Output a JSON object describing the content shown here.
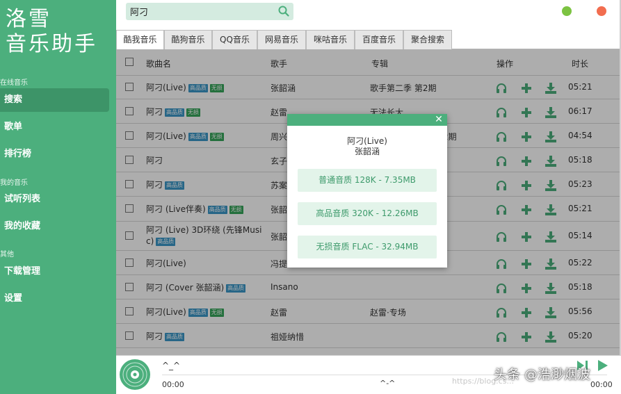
{
  "app": {
    "logo_line1": "洛雪",
    "logo_line2": "音乐助手"
  },
  "sidebar": {
    "sections": [
      {
        "title": "在线音乐",
        "items": [
          {
            "label": "搜索",
            "active": true
          },
          {
            "label": "歌单"
          },
          {
            "label": "排行榜"
          }
        ]
      },
      {
        "title": "我的音乐",
        "items": [
          {
            "label": "试听列表"
          },
          {
            "label": "我的收藏"
          }
        ]
      },
      {
        "title": "其他",
        "items": [
          {
            "label": "下载管理"
          },
          {
            "label": "设置"
          }
        ]
      }
    ]
  },
  "search": {
    "value": "阿刁",
    "icon": "search-icon"
  },
  "window_controls": {
    "minimize_color": "#7cc342",
    "close_color": "#f26d4f"
  },
  "tabs": [
    {
      "label": "酷我音乐",
      "active": true
    },
    {
      "label": "酷狗音乐"
    },
    {
      "label": "QQ音乐"
    },
    {
      "label": "网易音乐"
    },
    {
      "label": "咪咕音乐"
    },
    {
      "label": "百度音乐"
    },
    {
      "label": "聚合搜索"
    }
  ],
  "table": {
    "headers": {
      "name": "歌曲名",
      "singer": "歌手",
      "album": "专辑",
      "ops": "操作",
      "duration": "时长"
    },
    "op_icons": [
      "headphone-icon",
      "plus-icon",
      "download-icon"
    ],
    "rows": [
      {
        "name": "阿刁(Live)",
        "hq": "高品质",
        "lossless": "无损",
        "singer": "张韶涵",
        "album": "歌手第二季 第2期",
        "duration": "05:21"
      },
      {
        "name": "阿刁",
        "hq": "高品质",
        "lossless": "无损",
        "singer": "赵雷",
        "album": "无法长大",
        "duration": "06:17"
      },
      {
        "name": "阿刁(Live)",
        "hq": "高品质",
        "lossless": "无损",
        "singer": "周兴",
        "album": "2期",
        "duration": "04:54"
      },
      {
        "name": "阿刁",
        "singer": "玄子",
        "album": "",
        "duration": "05:18"
      },
      {
        "name": "阿刁",
        "hq": "高品质",
        "singer": "苏案",
        "album": "",
        "duration": "05:23"
      },
      {
        "name": "阿刁 (Live伴奏)",
        "hq": "高品质",
        "lossless": "无损",
        "singer": "张韶",
        "album": "",
        "duration": "05:21"
      },
      {
        "name": "阿刁 (Live) 3D环绕 (先锋Musi",
        "name2": "c)",
        "hq": "高品质",
        "singer": "张韶",
        "album": "",
        "duration": "05:14"
      },
      {
        "name": "阿刁(Live)",
        "singer": "冯提",
        "album": "",
        "duration": "05:22"
      },
      {
        "name": "阿刁 (Cover 张韶涵)",
        "hq": "高品质",
        "singer": "Insano",
        "album": "",
        "duration": "05:18"
      },
      {
        "name": "阿刁(Live)",
        "hq": "高品质",
        "lossless": "无损",
        "singer": "赵雷",
        "album": "赵雷·专场",
        "duration": "05:56"
      },
      {
        "name": "阿刁",
        "hq": "高品质",
        "singer": "祖娅纳惜",
        "album": "",
        "duration": "05:20"
      }
    ]
  },
  "dialog": {
    "song": "阿刁(Live)",
    "singer": "张韶涵",
    "close": "✕",
    "options": [
      "普通音质 128K - 7.35MB",
      "高品音质 320K - 12.26MB",
      "无损音质 FLAC - 32.94MB"
    ]
  },
  "player": {
    "title": "^_^",
    "time_current": "00:00",
    "lyric": "^-^",
    "time_total": "00:00"
  },
  "watermark": {
    "text": "头条 @浩渺烟波",
    "blog": "https://blog.cs..."
  },
  "colors": {
    "accent": "#4caf7d",
    "accent_dark": "#3d9468",
    "hq_badge": "#3a97c8",
    "lossless_badge": "#36a55b"
  }
}
